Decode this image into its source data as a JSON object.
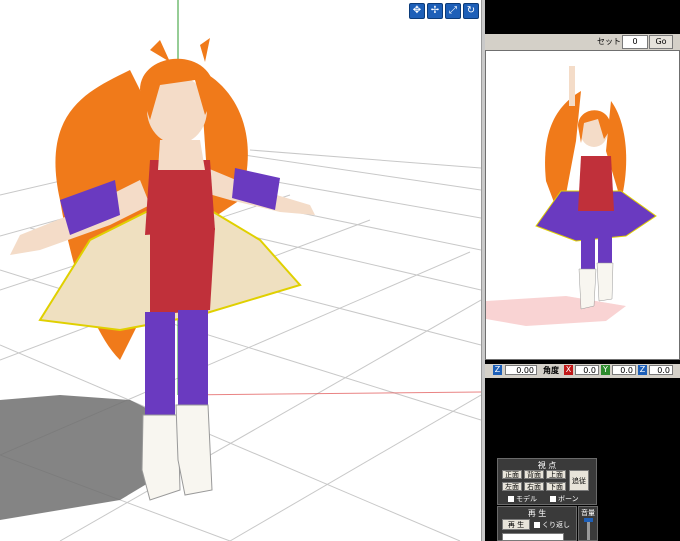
{
  "viewport": {
    "tool_icons": [
      "move-icon",
      "rotate-icon",
      "zoom-icon",
      "reset-icon"
    ],
    "tool_glyphs": [
      "✥",
      "✢",
      "⤢",
      "↻"
    ]
  },
  "preview": {
    "set_label": "セット",
    "set_value": "0",
    "go_label": "Go"
  },
  "angle_bar": {
    "z_left_label": "Z",
    "z_left_value": "0.00",
    "angle_label": "角度",
    "x_label": "X",
    "x_value": "0.0",
    "y_label": "Y",
    "y_value": "0.0",
    "z_label": "Z",
    "z_value": "0.0"
  },
  "viewpoint_panel": {
    "title": "視 点",
    "front": "正面",
    "back": "背面",
    "top": "上面",
    "left": "左面",
    "right": "右面",
    "bottom": "下面",
    "follow": "追従",
    "model_check": "モデル",
    "bone_check": "ボーン"
  },
  "play_panel": {
    "title": "再 生",
    "play": "再 生",
    "repeat": "くり返し"
  },
  "volume_panel": {
    "title": "音量"
  }
}
